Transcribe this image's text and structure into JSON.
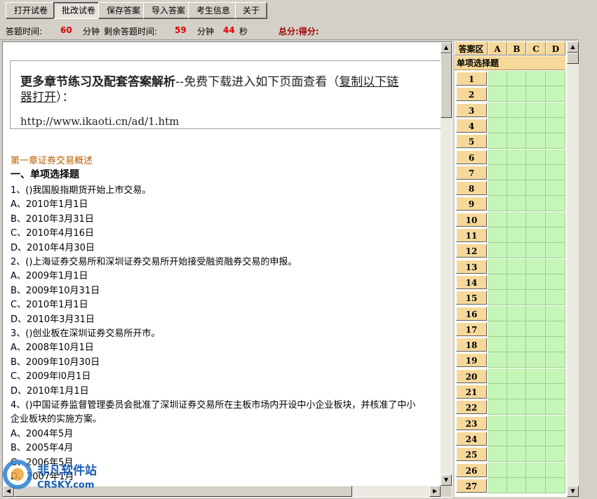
{
  "toolbar": {
    "buttons": [
      "打开试卷",
      "批改试卷",
      "保存答案",
      "导入答案",
      "考生信息",
      "关于"
    ]
  },
  "status": {
    "answer_time_label": "答题时间:",
    "answer_time_value": "60",
    "minutes_label": "分钟",
    "remaining_label": "剩余答题时间:",
    "remaining_minutes": "59",
    "minutes_label2": "分钟",
    "remaining_seconds": "44",
    "seconds_label": "秒",
    "total_label": "总分:得分:"
  },
  "ad": {
    "title_bold": "更多章节练习及配套答案解析",
    "title_rest": "--免费下载进入如下页面查看（",
    "title_link": "复制以下链",
    "line2_link": "器打开",
    "line2_rest": "）：",
    "url": "http://www.ikaoti.cn/ad/1.htm"
  },
  "document": {
    "chapter": "第一章证券交易概述",
    "section": "一、单项选择题",
    "lines": [
      "1、()我国股指期货开始上市交易。",
      "A、2010年1月1日",
      "B、2010年3月31日",
      "C、2010年4月16日",
      "D、2010年4月30日",
      "2、()上海证券交易所和深圳证券交易所开始接受融资融券交易的申报。",
      "A、2009年1月1日",
      "B、2009年10月31日",
      "C、2010年1月1日",
      "D、2010年3月31日",
      "3、()创业板在深圳证券交易所开市。",
      "A、2008年10月1日",
      "B、2009年10月30日",
      "C、2009年l0月1日",
      "D、2010年1月1日",
      "4、()中国证券监督管理委员会批准了深圳证券交易所在主板市场内开设中小企业板块，并核准了中小",
      "企业板块的实施方案。",
      "A、2004年5月",
      "B、2005年4月",
      "C、2006年5月",
      "D、2007年1月"
    ]
  },
  "answer_panel": {
    "header_label": "答案区",
    "options": [
      "A",
      "B",
      "C",
      "D"
    ],
    "section_label": "单项选择题",
    "rows": [
      "1",
      "2",
      "3",
      "4",
      "5",
      "6",
      "7",
      "8",
      "9",
      "10",
      "11",
      "12",
      "13",
      "14",
      "15",
      "16",
      "17",
      "18",
      "19",
      "20",
      "21",
      "22",
      "23",
      "24",
      "25",
      "26",
      "27"
    ]
  },
  "watermark": {
    "cn": "非凡软件站",
    "en": "CRSKY.com"
  },
  "colors": {
    "window_bg": "#d4d0c8",
    "answer_header": "#f6d99a",
    "answer_cell": "#c6f5b8",
    "timer_red": "#e00000",
    "chapter_brown": "#b85c00"
  }
}
